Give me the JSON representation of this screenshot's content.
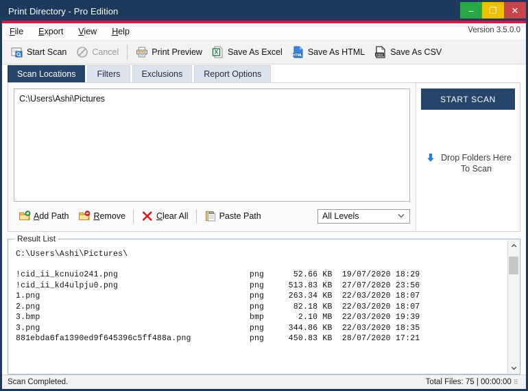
{
  "window": {
    "title": "Print Directory - Pro Edition",
    "buttons": {
      "minimize": "–",
      "maximize": "❐",
      "close": "✕"
    }
  },
  "menu": {
    "items": [
      {
        "label": "File",
        "accel": "F"
      },
      {
        "label": "Export",
        "accel": "E"
      },
      {
        "label": "View",
        "accel": "V"
      },
      {
        "label": "Help",
        "accel": "H"
      }
    ],
    "version": "Version 3.5.0.0"
  },
  "toolbar": {
    "items": [
      {
        "label": "Start Scan",
        "icon": "scan-icon",
        "disabled": false
      },
      {
        "label": "Cancel",
        "icon": "cancel-icon",
        "disabled": true
      },
      {
        "label": "Print Preview",
        "icon": "printer-icon",
        "disabled": false
      },
      {
        "label": "Save As Excel",
        "icon": "excel-icon",
        "disabled": false
      },
      {
        "label": "Save As HTML",
        "icon": "html-icon",
        "disabled": false
      },
      {
        "label": "Save As CSV",
        "icon": "csv-icon",
        "disabled": false
      }
    ]
  },
  "tabs": [
    {
      "label": "Scan Locations",
      "active": true
    },
    {
      "label": "Filters",
      "active": false
    },
    {
      "label": "Exclusions",
      "active": false
    },
    {
      "label": "Report Options",
      "active": false
    }
  ],
  "scan_panel": {
    "paths": [
      "C:\\Users\\Ashi\\Pictures"
    ],
    "actions": [
      {
        "label": "Add Path",
        "accel": "A",
        "icon": "folder-add-icon"
      },
      {
        "label": "Remove",
        "accel": "R",
        "icon": "folder-remove-icon"
      },
      {
        "label": "Clear All",
        "accel": "C",
        "icon": "red-x-icon"
      },
      {
        "label": "Paste Path",
        "accel": "",
        "icon": "clipboard-icon"
      }
    ],
    "levels_selected": "All Levels",
    "start_scan_label": "START SCAN",
    "drop_hint_line1": "Drop Folders Here",
    "drop_hint_line2": "To Scan"
  },
  "results": {
    "legend": "Result List",
    "header": "C:\\Users\\Ashi\\Pictures\\",
    "rows": [
      {
        "name": "!cid_ii_kcnuio241.png",
        "ext": "png",
        "size": "52.66 KB",
        "date": "19/07/2020",
        "time": "18:29"
      },
      {
        "name": "!cid_ii_kd4ulpju0.png",
        "ext": "png",
        "size": "513.83 KB",
        "date": "27/07/2020",
        "time": "23:56"
      },
      {
        "name": "1.png",
        "ext": "png",
        "size": "263.34 KB",
        "date": "22/03/2020",
        "time": "18:07"
      },
      {
        "name": "2.png",
        "ext": "png",
        "size": "82.18 KB",
        "date": "22/03/2020",
        "time": "18:07"
      },
      {
        "name": "3.bmp",
        "ext": "bmp",
        "size": "2.10 MB",
        "date": "22/03/2020",
        "time": "19:39"
      },
      {
        "name": "3.png",
        "ext": "png",
        "size": "344.86 KB",
        "date": "22/03/2020",
        "time": "18:35"
      },
      {
        "name": "881ebda6fa1390ed9f645396c5ff488a.png",
        "ext": "png",
        "size": "450.83 KB",
        "date": "28/07/2020",
        "time": "17:21"
      }
    ]
  },
  "statusbar": {
    "message": "Scan Completed.",
    "total_files": "Total Files: 75",
    "separator": "|",
    "elapsed": "00:00:00"
  },
  "colors": {
    "title_bar": "#1d3a5c",
    "accent_red": "#d81b45",
    "active_tab": "#27456a",
    "minimize": "#28a745",
    "maximize": "#f0c000",
    "close": "#c9444a"
  }
}
